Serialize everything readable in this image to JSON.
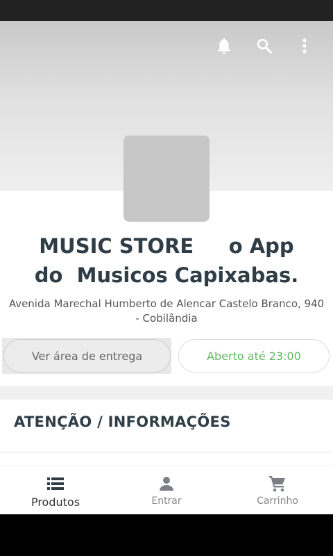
{
  "header": {
    "actions": [
      {
        "name": "notifications",
        "icon": "bell-icon"
      },
      {
        "name": "search",
        "icon": "search-icon"
      },
      {
        "name": "more",
        "icon": "more-vert-icon"
      }
    ]
  },
  "store": {
    "name": "MUSIC STORE     o App\ndo  Musicos Capixabas.",
    "address": "Avenida Marechal Humberto de Alencar Castelo Branco, 940 - Cobilândia"
  },
  "buttons": {
    "delivery_area": "Ver área de entrega",
    "open_status": "Aberto até 23:00"
  },
  "section": {
    "title": "ATENÇÃO / INFORMAÇÕES"
  },
  "bottom_nav": {
    "items": [
      {
        "label": "Produtos",
        "icon": "list-icon",
        "active": true
      },
      {
        "label": "Entrar",
        "icon": "person-icon",
        "active": false
      },
      {
        "label": "Carrinho",
        "icon": "cart-icon",
        "active": false
      }
    ]
  },
  "colors": {
    "open_status": "#5cb85c",
    "title_text": "#2f3d47"
  }
}
